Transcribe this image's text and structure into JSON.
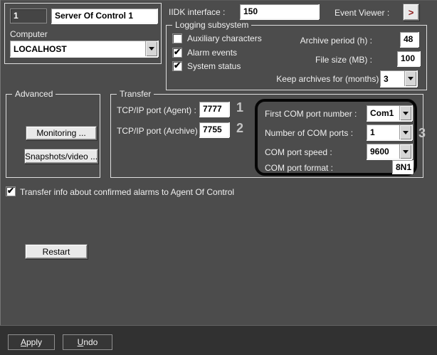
{
  "colors": {
    "panel_bg": "#4c4c4c",
    "footer_bg": "#313131",
    "field_bg": "#ffffff",
    "highlight_border": "#060606",
    "annotation_text": "#c4c4c4",
    "event_viewer_arrow": "#8c1a1a",
    "light_button_bg": "#e9e9e9"
  },
  "header": {
    "id_value": "1",
    "name_value": "Server Of Control 1",
    "computer_label": "Computer",
    "computer_value": "LOCALHOST",
    "iidk_label": "IIDK interface :",
    "iidk_value": "150",
    "event_viewer_label": "Event Viewer :",
    "event_viewer_button": ">"
  },
  "logging": {
    "title": "Logging subsystem",
    "checkboxes": [
      {
        "label": "Auxiliary characters",
        "checked": false
      },
      {
        "label": "Alarm events",
        "checked": true
      },
      {
        "label": "System status",
        "checked": true
      }
    ],
    "archive_period_label": "Archive period (h) :",
    "archive_period_value": "48",
    "file_size_label": "File size (MB) :",
    "file_size_value": "100",
    "keep_archives_label": "Keep archives for (months) :",
    "keep_archives_value": "3"
  },
  "advanced": {
    "title": "Advanced",
    "monitoring_button": "Monitoring ...",
    "snapshots_button": "Snapshots/video ..."
  },
  "transfer": {
    "title": "Transfer",
    "agent_port_label": "TCP/IP port (Agent) :",
    "agent_port_value": "7777",
    "agent_annotation": "1",
    "archive_port_label": "TCP/IP port (Archive) :",
    "archive_port_value": "7755",
    "archive_annotation": "2",
    "com": {
      "first_port_label": "First COM port number :",
      "first_port_value": "Com1",
      "num_ports_label": "Number of COM ports :",
      "num_ports_value": "1",
      "speed_label": "COM port speed :",
      "speed_value": "9600",
      "format_label": "COM port format :",
      "format_value": "8N1",
      "annotation": "3"
    }
  },
  "alarm_checkbox": {
    "label": "Transfer info about confirmed alarms to Agent Of Control",
    "checked": true
  },
  "restart_button": "Restart",
  "footer": {
    "apply_button": "Apply",
    "undo_button": "Undo"
  }
}
